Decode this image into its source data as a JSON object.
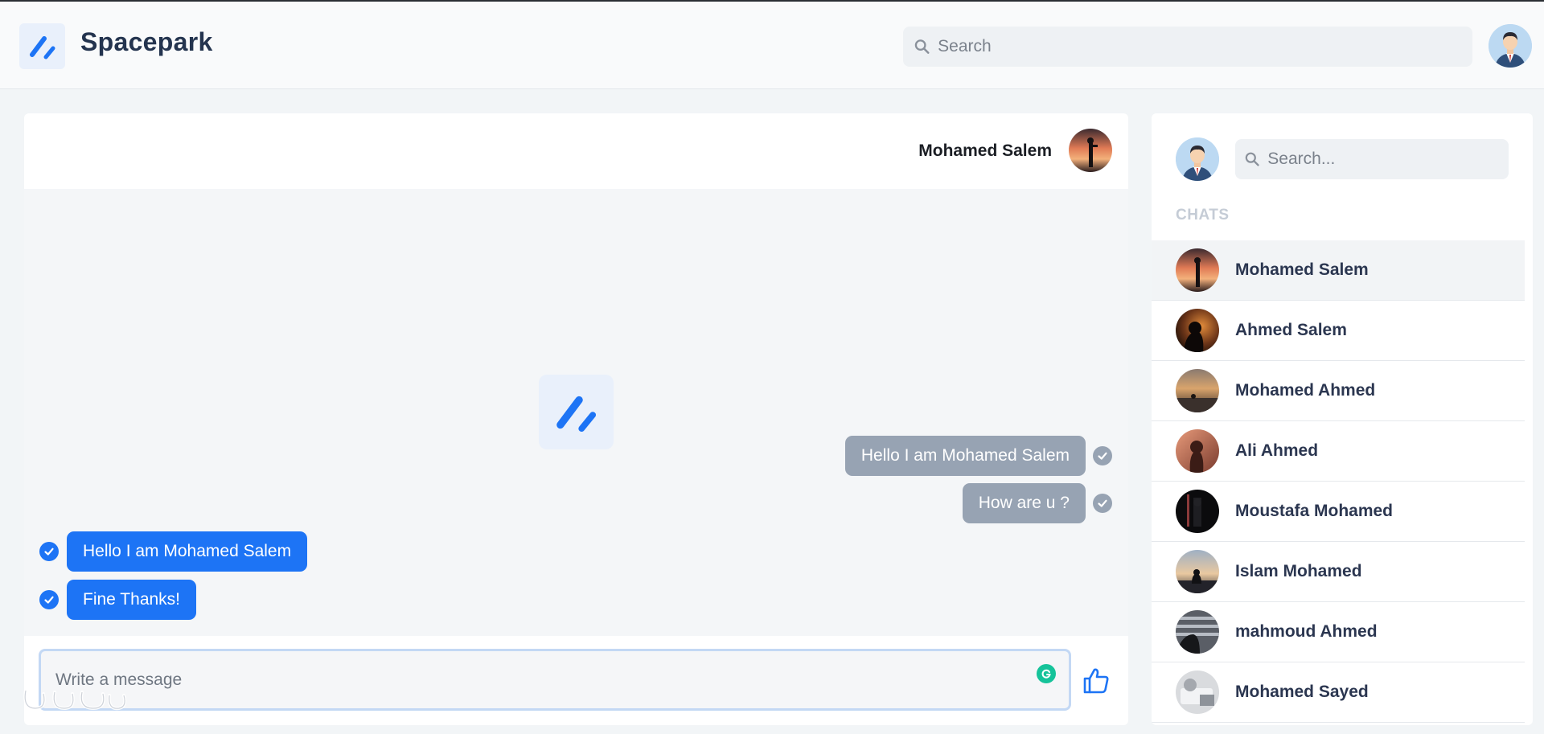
{
  "app": {
    "brand": "Spacepark"
  },
  "colors": {
    "accent": "#1d74f5",
    "sent_bubble": "#97a3b3",
    "brand_text": "#24344f"
  },
  "header": {
    "search_placeholder": "Search",
    "avatar_icon": "user-avatar-icon"
  },
  "chat": {
    "contact_name": "Mohamed Salem",
    "messages": [
      {
        "text": "Hello I am Mohamed Salem",
        "direction": "sent",
        "status": "read"
      },
      {
        "text": "How are u ?",
        "direction": "sent",
        "status": "read"
      },
      {
        "text": "Hello I am Mohamed Salem",
        "direction": "received",
        "status": "read"
      },
      {
        "text": "Fine Thanks!",
        "direction": "received",
        "status": "read"
      }
    ],
    "composer_placeholder": "Write a message",
    "send_icon": "thumbs-up-icon"
  },
  "sidebar": {
    "search_placeholder": "Search...",
    "section_label": "CHATS",
    "chats": [
      {
        "name": "Mohamed Salem",
        "active": true
      },
      {
        "name": "Ahmed Salem",
        "active": false
      },
      {
        "name": "Mohamed Ahmed",
        "active": false
      },
      {
        "name": "Ali Ahmed",
        "active": false
      },
      {
        "name": "Moustafa Mohamed",
        "active": false
      },
      {
        "name": "Islam Mohamed",
        "active": false
      },
      {
        "name": "mahmoud Ahmed",
        "active": false
      },
      {
        "name": "Mohamed Sayed",
        "active": false
      }
    ]
  }
}
